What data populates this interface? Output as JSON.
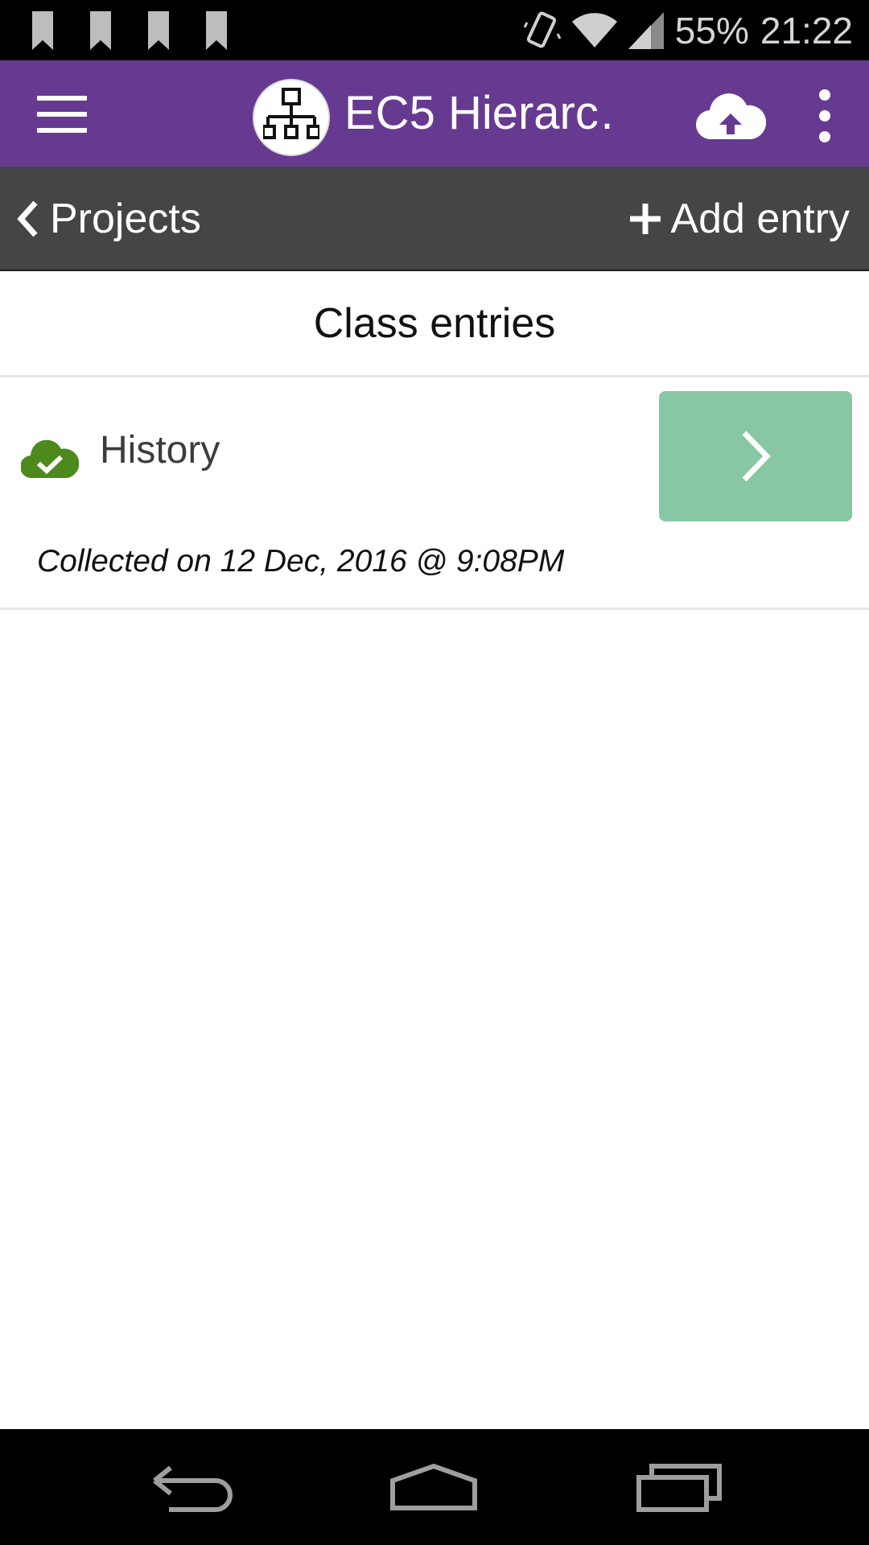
{
  "status_bar": {
    "battery": "55%",
    "time": "21:22",
    "notification_icons": [
      "bookmark-icon",
      "bookmark-icon",
      "bookmark-icon",
      "bookmark-icon"
    ],
    "system_icons": [
      "vibrate-icon",
      "wifi-icon",
      "signal-icon"
    ]
  },
  "app_bar": {
    "title": "EC5 Hierarc…",
    "logo_icon": "hierarchy-icon",
    "actions": [
      "menu-icon",
      "cloud-upload-icon",
      "more-vert-icon"
    ],
    "color": "#673a91"
  },
  "nav_bar": {
    "back_label": "Projects",
    "add_label": "Add entry",
    "color": "#454545"
  },
  "section": {
    "title": "Class entries"
  },
  "entries": [
    {
      "title": "History",
      "collected": "Collected on 12 Dec, 2016 @ 9:08PM",
      "status_icon": "cloud-check-icon",
      "status_color": "#4d8a1c",
      "button_color": "#88c7a3"
    }
  ],
  "system_nav": {
    "buttons": [
      "back-icon",
      "home-icon",
      "recents-icon"
    ]
  }
}
